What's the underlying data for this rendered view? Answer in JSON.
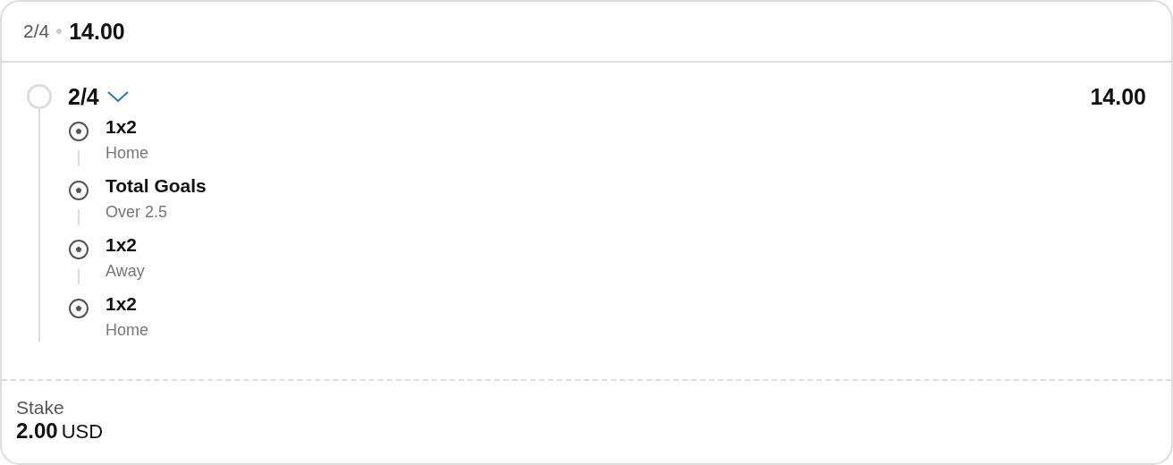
{
  "header": {
    "count": "2/4",
    "odds": "14.00"
  },
  "system": {
    "selected": false,
    "label": "2/4",
    "expanded": true,
    "odds": "14.00",
    "legs": [
      {
        "market": "1x2",
        "selection": "Home"
      },
      {
        "market": "Total Goals",
        "selection": "Over 2.5"
      },
      {
        "market": "1x2",
        "selection": "Away"
      },
      {
        "market": "1x2",
        "selection": "Home"
      }
    ]
  },
  "stake": {
    "label": "Stake",
    "amount": "2.00",
    "currency": "USD"
  }
}
